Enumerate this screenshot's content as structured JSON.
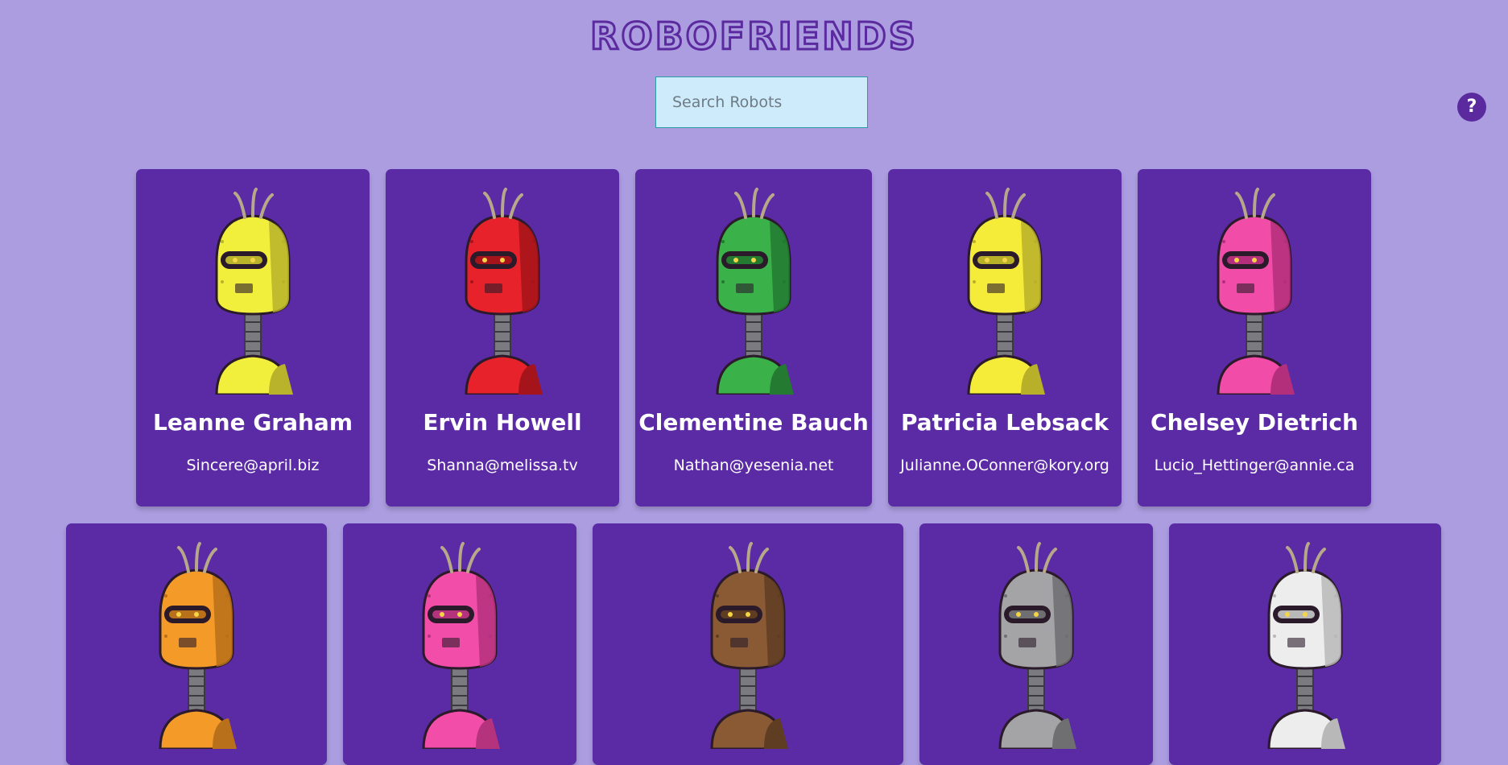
{
  "app": {
    "title": "ROBOFRIENDS"
  },
  "search": {
    "placeholder": "Search Robots",
    "value": ""
  },
  "help_label": "?",
  "robots": [
    {
      "name": "Leanne Graham",
      "email": "Sincere@april.biz",
      "color": "#f2ee3c",
      "dark": "#b8b32a"
    },
    {
      "name": "Ervin Howell",
      "email": "Shanna@melissa.tv",
      "color": "#e8222a",
      "dark": "#a5141a"
    },
    {
      "name": "Clementine Bauch",
      "email": "Nathan@yesenia.net",
      "color": "#3bb14a",
      "dark": "#237a30"
    },
    {
      "name": "Patricia Lebsack",
      "email": "Julianne.OConner@kory.org",
      "color": "#f5ec3a",
      "dark": "#b9b02a"
    },
    {
      "name": "Chelsey Dietrich",
      "email": "Lucio_Hettinger@annie.ca",
      "color": "#f14ca8",
      "dark": "#b32f7b"
    },
    {
      "name": "",
      "email": "",
      "color": "#f49a28",
      "dark": "#b9701a"
    },
    {
      "name": "",
      "email": "",
      "color": "#f24ea9",
      "dark": "#b5337c"
    },
    {
      "name": "",
      "email": "",
      "color": "#8a5a35",
      "dark": "#5f3d22"
    },
    {
      "name": "",
      "email": "",
      "color": "#a4a4a6",
      "dark": "#6f6f72"
    },
    {
      "name": "",
      "email": "",
      "color": "#ededed",
      "dark": "#b8b8b8"
    }
  ]
}
